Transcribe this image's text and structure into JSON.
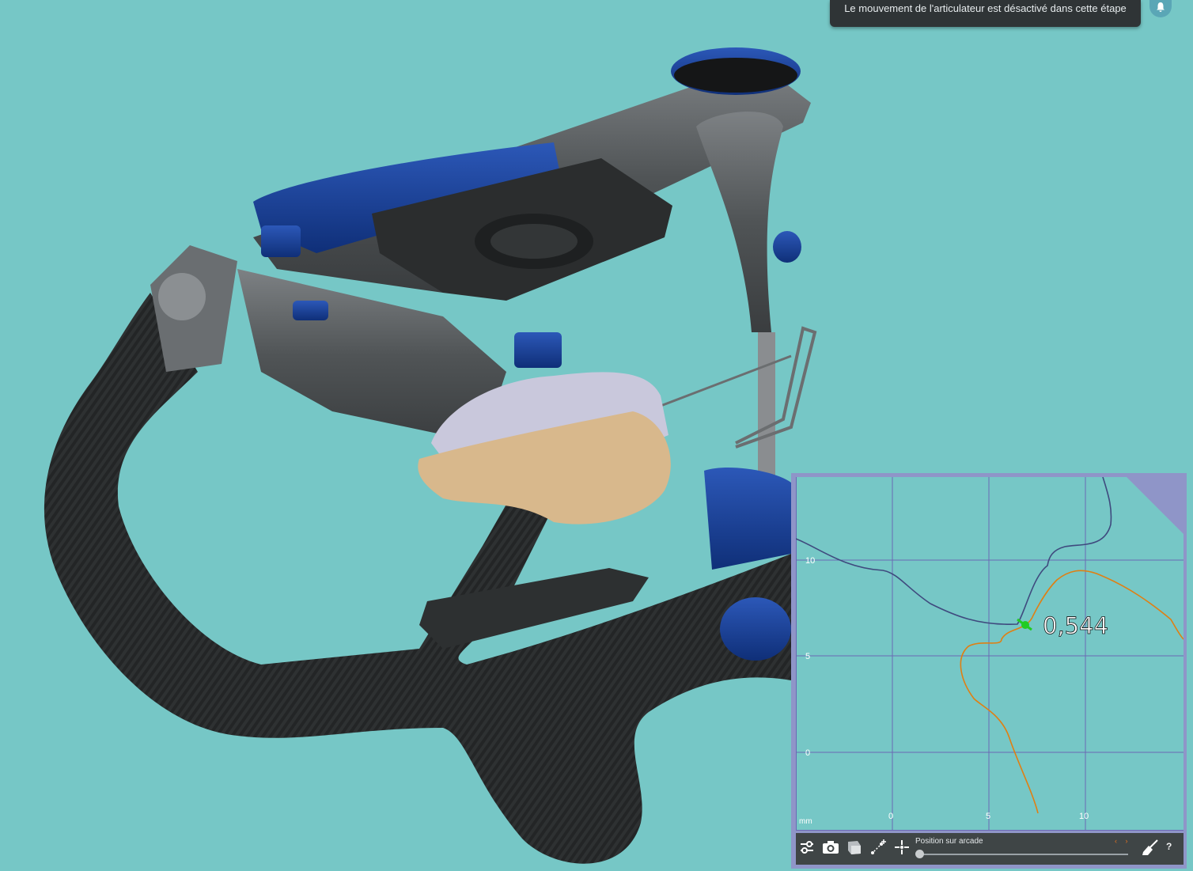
{
  "notification": {
    "message": "Le mouvement de l'articulateur est désactivé dans cette étape",
    "icon": "bell-icon"
  },
  "scene": {
    "background": "#76c7c6",
    "description_icon": "articulator-3d-model"
  },
  "graph": {
    "value_label": "0,544",
    "unit": "mm",
    "x_ticks": [
      "0",
      "5",
      "10"
    ],
    "y_ticks": [
      "10",
      "5",
      "0"
    ],
    "colors": {
      "trace_1": "#3f4a7e",
      "trace_2": "#e07f12",
      "marker": "#22cc22",
      "grid": "#6b68b4"
    }
  },
  "toolbar": {
    "buttons": [
      "settings-sliders-icon",
      "camera-icon",
      "view-cube-icon",
      "measure-tool-icon",
      "center-point-icon"
    ],
    "slider_label": "Position sur arcade",
    "slider_value": 0,
    "clear_icon": "broom-icon",
    "help_label": "?"
  }
}
